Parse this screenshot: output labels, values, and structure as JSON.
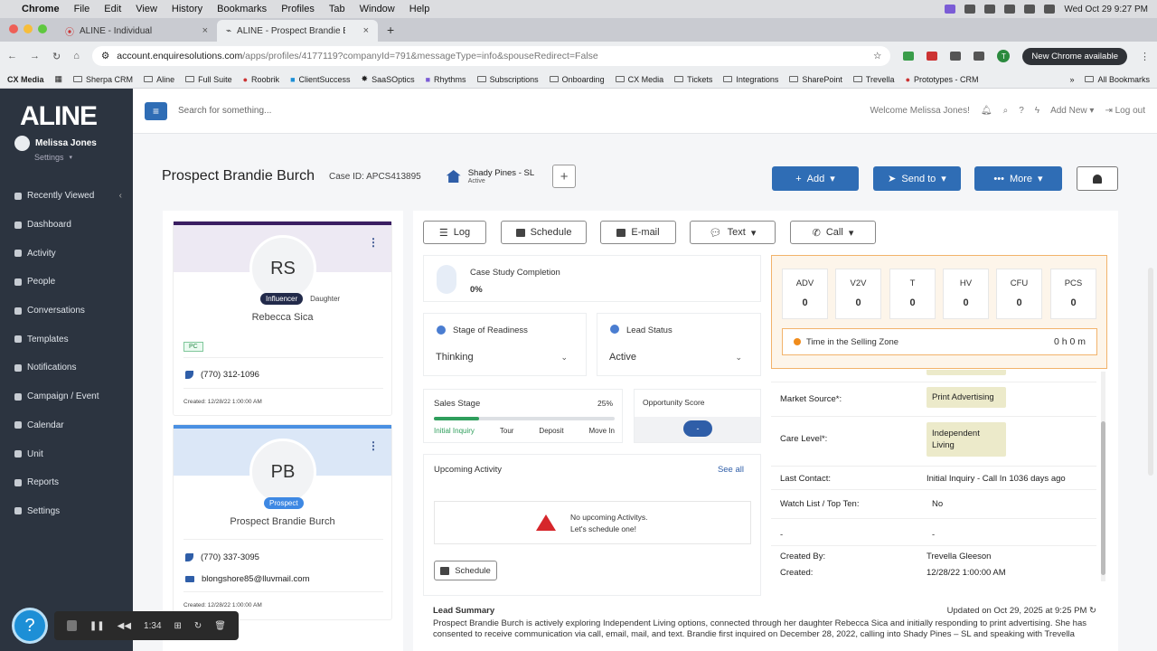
{
  "mac": {
    "app": "Chrome",
    "menus": [
      "File",
      "Edit",
      "View",
      "History",
      "Bookmarks",
      "Profiles",
      "Tab",
      "Window",
      "Help"
    ],
    "datetime": "Wed Oct 29  9:27 PM"
  },
  "tabs": [
    {
      "title": "ALINE - Individual"
    },
    {
      "title": "ALINE - Prospect Brandie Bur"
    }
  ],
  "url": {
    "host": "account.enquiresolutions.com",
    "path": "/apps/profiles/4177119?companyId=791&messageType=info&spouseRedirect=False"
  },
  "chrome": {
    "update_label": "New Chrome available",
    "profile_initial": "T"
  },
  "bookmarks": [
    "CX Media",
    "Sherpa CRM",
    "Aline",
    "Full Suite",
    "Roobrik",
    "ClientSuccess",
    "SaaSOptics",
    "Rhythms",
    "Subscriptions",
    "Onboarding",
    "CX Media",
    "Tickets",
    "Integrations",
    "SharePoint",
    "Trevella",
    "Prototypes - CRM"
  ],
  "bookmarks_all": "All Bookmarks",
  "sidebar": {
    "logo": "ALINE",
    "user_name": "Melissa Jones",
    "user_settings": "Settings",
    "items": [
      {
        "label": "Recently Viewed"
      },
      {
        "label": "Dashboard"
      },
      {
        "label": "Activity"
      },
      {
        "label": "People"
      },
      {
        "label": "Conversations"
      },
      {
        "label": "Templates"
      },
      {
        "label": "Notifications"
      },
      {
        "label": "Campaign / Event"
      },
      {
        "label": "Calendar"
      },
      {
        "label": "Unit"
      },
      {
        "label": "Reports"
      },
      {
        "label": "Settings"
      }
    ]
  },
  "topbar": {
    "search_placeholder": "Search for something...",
    "welcome": "Welcome Melissa Jones!",
    "add_new": "Add New",
    "logout": "Log out"
  },
  "header": {
    "title": "Prospect Brandie Burch",
    "case_id": "Case ID: APCS413895",
    "community": "Shady Pines - SL",
    "community_status": "Active",
    "add": "Add",
    "send_to": "Send to",
    "more": "More"
  },
  "contacts": [
    {
      "initials": "RS",
      "role": "Influencer",
      "relation": "Daughter",
      "name": "Rebecca Sica",
      "tag": "PC",
      "phone": "(770) 312-1096",
      "created": "Created: 12/28/22 1:00:00 AM"
    },
    {
      "initials": "PB",
      "role": "Prospect",
      "name": "Prospect Brandie Burch",
      "phone": "(770) 337-3095",
      "email": "blongshore85@lluvmail.com",
      "created": "Created: 12/28/22 1:00:00 AM"
    }
  ],
  "actions": {
    "log": "Log",
    "schedule": "Schedule",
    "email": "E-mail",
    "text": "Text",
    "call": "Call"
  },
  "case_study": {
    "label": "Case Study Completion",
    "value": "0%"
  },
  "stage": {
    "label": "Stage of Readiness",
    "value": "Thinking"
  },
  "lead_status": {
    "label": "Lead Status",
    "value": "Active"
  },
  "sales_stage": {
    "label": "Sales Stage",
    "percent": "25%",
    "progress": 0.25,
    "steps": [
      "Initial Inquiry",
      "Tour",
      "Deposit",
      "Move In"
    ]
  },
  "opportunity": {
    "label": "Opportunity Score",
    "value": "-"
  },
  "upcoming": {
    "label": "Upcoming Activity",
    "see_all": "See all",
    "empty1": "No upcoming Activitys.",
    "empty2": "Let's schedule one!",
    "schedule": "Schedule"
  },
  "metrics": [
    {
      "label": "ADV",
      "value": "0"
    },
    {
      "label": "V2V",
      "value": "0"
    },
    {
      "label": "T",
      "value": "0"
    },
    {
      "label": "HV",
      "value": "0"
    },
    {
      "label": "CFU",
      "value": "0"
    },
    {
      "label": "PCS",
      "value": "0"
    }
  ],
  "selling_zone": {
    "label": "Time in the Selling Zone",
    "value": "0 h 0 m"
  },
  "details": [
    {
      "key": "Market Source*:",
      "value": "Print Advertising"
    },
    {
      "key": "Care Level*:",
      "value": "Independent Living"
    },
    {
      "key": "Last Contact:",
      "value": "Initial Inquiry - Call In 1036 days ago"
    },
    {
      "key": "Watch List / Top Ten:",
      "value": "No"
    },
    {
      "key": "-",
      "value": "-"
    },
    {
      "key": "Created By:",
      "value": "Trevella Gleeson"
    },
    {
      "key": "Created:",
      "value": "12/28/22 1:00:00 AM"
    }
  ],
  "lead_summary": {
    "label": "Lead Summary",
    "updated": "Updated on Oct 29, 2025 at 9:25 PM",
    "text": "Prospect Brandie Burch is actively exploring Independent Living options, connected through her daughter Rebecca Sica and initially responding to print advertising. She has consented to receive communication via call, email, mail, and text. Brandie first inquired on December 28, 2022, calling into Shady Pines – SL and speaking with Trevella"
  },
  "recorder": {
    "time": "1:34"
  },
  "colors": {
    "sidebar": "#2c3440",
    "primary": "#2f6db5",
    "orange_border": "#f2b36b",
    "chip": "#eceaca"
  }
}
